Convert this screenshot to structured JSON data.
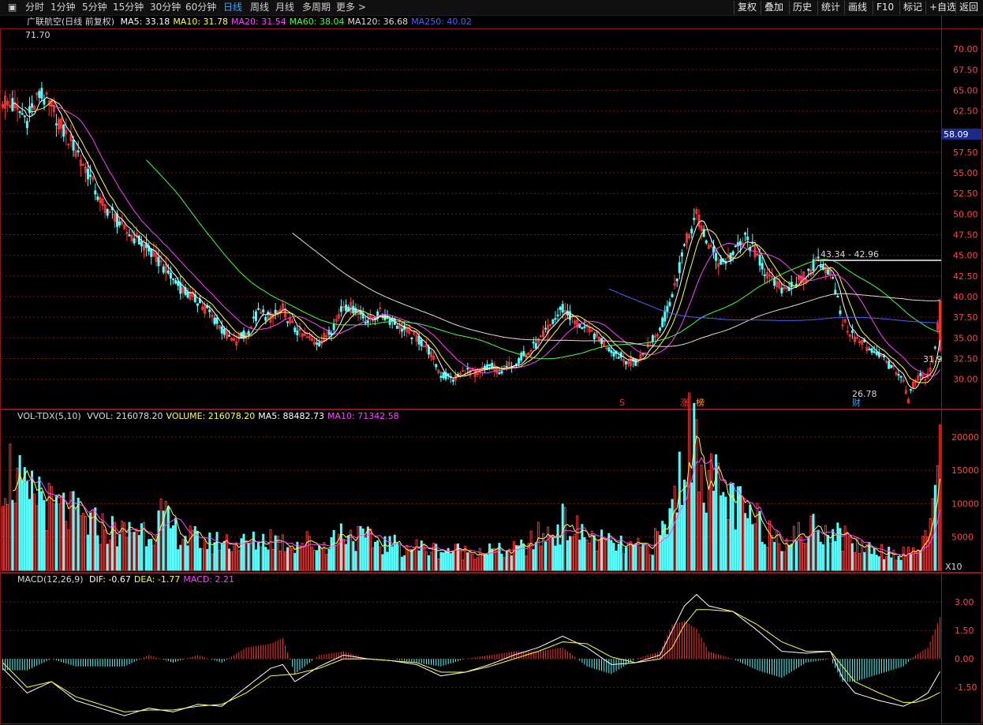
{
  "toolbar": {
    "left_items": [
      "分时",
      "1分钟",
      "5分钟",
      "15分钟",
      "30分钟",
      "60分钟",
      "日线",
      "周线",
      "月线",
      "多周期",
      "更多 >"
    ],
    "active_item": "日线",
    "right_items": [
      "复权",
      "叠加",
      "历史",
      "统计",
      "画线",
      "F10",
      "标记",
      "+自选",
      "返回"
    ]
  },
  "panels": {
    "main": {
      "title": "广联航空(日线 前复权)",
      "ma_legend": [
        {
          "label": "MA5: 33.18",
          "color": "#ffffff"
        },
        {
          "label": "MA10: 31.78",
          "color": "#ffff44"
        },
        {
          "label": "MA20: 31.54",
          "color": "#ff44ff"
        },
        {
          "label": "MA60: 38.04",
          "color": "#44ff44"
        },
        {
          "label": "MA120: 36.68",
          "color": "#dddddd"
        },
        {
          "label": "MA250: 40.02",
          "color": "#4466ff"
        }
      ],
      "annotations": {
        "high_label": "71.70",
        "low_label": "26.78",
        "range_label": "43.34 - 42.96",
        "last_label": "31.9",
        "current_price_tag": "58.09",
        "markers": [
          "S",
          "涨",
          "榜",
          "财"
        ]
      }
    },
    "volume": {
      "title": "VOL-TDX(5,10)",
      "legend": [
        {
          "label": "VVOL: 216078.20",
          "color": "#dddddd"
        },
        {
          "label": "VOLUME: 216078.20",
          "color": "#ffff44"
        },
        {
          "label": "MA5: 88482.73",
          "color": "#ffffff"
        },
        {
          "label": "MA10: 71342.58",
          "color": "#ff44ff"
        }
      ],
      "unit_label": "X10"
    },
    "macd": {
      "title": "MACD(12,26,9)",
      "legend": [
        {
          "label": "DIF: -0.67",
          "color": "#ffffff"
        },
        {
          "label": "DEA: -1.77",
          "color": "#ffff44"
        },
        {
          "label": "MACD: 2.21",
          "color": "#ff44ff"
        }
      ]
    }
  },
  "colors": {
    "up": "#ff3232",
    "down": "#54ffff",
    "grid": "#7a1616",
    "axis_text": "#ff4646"
  },
  "chart_data": [
    {
      "type": "candlestick",
      "title": "广联航空(日线 前复权)",
      "ylim": [
        27.0,
        72.5
      ],
      "yticks": [
        30.0,
        32.5,
        35.0,
        37.5,
        40.0,
        42.5,
        45.0,
        47.5,
        50.0,
        52.5,
        55.0,
        57.5,
        60.0,
        62.5,
        65.0,
        67.5,
        70.0
      ],
      "close_anchors": [
        [
          0,
          64.0
        ],
        [
          5,
          62.8
        ],
        [
          10,
          61.5
        ],
        [
          15,
          64.5
        ],
        [
          20,
          63.0
        ],
        [
          25,
          60.0
        ],
        [
          30,
          58.0
        ],
        [
          35,
          55.0
        ],
        [
          40,
          51.5
        ],
        [
          45,
          50.0
        ],
        [
          50,
          48.0
        ],
        [
          55,
          47.0
        ],
        [
          60,
          45.5
        ],
        [
          65,
          44.0
        ],
        [
          70,
          42.0
        ],
        [
          75,
          40.5
        ],
        [
          80,
          39.5
        ],
        [
          85,
          38.0
        ],
        [
          90,
          36.0
        ],
        [
          95,
          34.5
        ],
        [
          100,
          35.5
        ],
        [
          105,
          38.0
        ],
        [
          110,
          37.5
        ],
        [
          115,
          38.5
        ],
        [
          120,
          36.0
        ],
        [
          125,
          35.0
        ],
        [
          130,
          34.5
        ],
        [
          135,
          36.0
        ],
        [
          140,
          39.0
        ],
        [
          145,
          38.5
        ],
        [
          150,
          37.0
        ],
        [
          155,
          38.0
        ],
        [
          160,
          37.0
        ],
        [
          165,
          36.0
        ],
        [
          170,
          35.0
        ],
        [
          175,
          33.5
        ],
        [
          180,
          30.5
        ],
        [
          185,
          30.0
        ],
        [
          190,
          31.0
        ],
        [
          195,
          30.8
        ],
        [
          200,
          31.5
        ],
        [
          205,
          31.0
        ],
        [
          210,
          32.0
        ],
        [
          215,
          33.0
        ],
        [
          220,
          34.5
        ],
        [
          225,
          36.5
        ],
        [
          230,
          38.5
        ],
        [
          235,
          37.0
        ],
        [
          240,
          36.0
        ],
        [
          245,
          35.0
        ],
        [
          250,
          33.5
        ],
        [
          255,
          32.5
        ],
        [
          260,
          32.0
        ],
        [
          265,
          34.0
        ],
        [
          270,
          36.0
        ],
        [
          275,
          40.0
        ],
        [
          280,
          46.0
        ],
        [
          285,
          50.0
        ],
        [
          290,
          46.0
        ],
        [
          295,
          44.0
        ],
        [
          300,
          45.0
        ],
        [
          305,
          47.0
        ],
        [
          310,
          45.0
        ],
        [
          315,
          42.0
        ],
        [
          320,
          41.0
        ],
        [
          325,
          41.5
        ],
        [
          330,
          42.5
        ],
        [
          335,
          44.5
        ],
        [
          340,
          43.0
        ],
        [
          345,
          37.0
        ],
        [
          350,
          35.0
        ],
        [
          355,
          34.0
        ],
        [
          360,
          33.0
        ],
        [
          365,
          31.5
        ],
        [
          370,
          29.5
        ],
        [
          372,
          27.5
        ],
        [
          375,
          30.0
        ],
        [
          380,
          30.5
        ],
        [
          383,
          33.5
        ],
        [
          385,
          39.5
        ]
      ],
      "ma_series": [
        "MA5",
        "MA10",
        "MA20",
        "MA60",
        "MA120",
        "MA250"
      ]
    },
    {
      "type": "bar",
      "title": "VOL-TDX(5,10)",
      "ylim": [
        0,
        22000
      ],
      "yticks": [
        5000,
        10000,
        15000,
        20000
      ],
      "volume_anchors": [
        [
          0,
          16000
        ],
        [
          5,
          14000
        ],
        [
          10,
          10000
        ],
        [
          15,
          12000
        ],
        [
          20,
          9000
        ],
        [
          25,
          9000
        ],
        [
          30,
          8000
        ],
        [
          35,
          7000
        ],
        [
          40,
          6500
        ],
        [
          45,
          6000
        ],
        [
          50,
          5500
        ],
        [
          55,
          6500
        ],
        [
          60,
          6000
        ],
        [
          65,
          8000
        ],
        [
          70,
          6000
        ],
        [
          75,
          5000
        ],
        [
          80,
          4500
        ],
        [
          85,
          4000
        ],
        [
          90,
          4500
        ],
        [
          95,
          4200
        ],
        [
          100,
          4000
        ],
        [
          105,
          4300
        ],
        [
          110,
          5000
        ],
        [
          115,
          4200
        ],
        [
          120,
          4000
        ],
        [
          125,
          4300
        ],
        [
          130,
          3500
        ],
        [
          135,
          4500
        ],
        [
          140,
          6000
        ],
        [
          145,
          5000
        ],
        [
          150,
          4500
        ],
        [
          155,
          4000
        ],
        [
          160,
          3800
        ],
        [
          165,
          3500
        ],
        [
          170,
          3500
        ],
        [
          175,
          3200
        ],
        [
          180,
          3000
        ],
        [
          185,
          3000
        ],
        [
          190,
          2800
        ],
        [
          195,
          3000
        ],
        [
          200,
          3000
        ],
        [
          205,
          2800
        ],
        [
          210,
          3000
        ],
        [
          215,
          3500
        ],
        [
          220,
          5000
        ],
        [
          225,
          5500
        ],
        [
          230,
          7000
        ],
        [
          235,
          6000
        ],
        [
          240,
          5000
        ],
        [
          245,
          4500
        ],
        [
          250,
          3800
        ],
        [
          255,
          3500
        ],
        [
          260,
          3300
        ],
        [
          265,
          3500
        ],
        [
          270,
          5000
        ],
        [
          275,
          9000
        ],
        [
          280,
          18000
        ],
        [
          285,
          20000
        ],
        [
          290,
          14000
        ],
        [
          295,
          11000
        ],
        [
          300,
          10000
        ],
        [
          305,
          8000
        ],
        [
          310,
          7000
        ],
        [
          315,
          6000
        ],
        [
          320,
          5000
        ],
        [
          325,
          5000
        ],
        [
          330,
          5500
        ],
        [
          335,
          7000
        ],
        [
          340,
          6000
        ],
        [
          345,
          5000
        ],
        [
          350,
          4000
        ],
        [
          355,
          3500
        ],
        [
          360,
          3000
        ],
        [
          365,
          2800
        ],
        [
          370,
          2500
        ],
        [
          375,
          3000
        ],
        [
          380,
          6000
        ],
        [
          383,
          9000
        ],
        [
          385,
          21800
        ]
      ]
    },
    {
      "type": "bar",
      "title": "MACD(12,26,9)",
      "ylim": [
        -3.2,
        3.8
      ],
      "yticks": [
        -1.5,
        0.0,
        1.5,
        3.0
      ],
      "dif_anchors": [
        [
          0,
          -0.5
        ],
        [
          10,
          -1.8
        ],
        [
          20,
          -1.2
        ],
        [
          30,
          -2.2
        ],
        [
          40,
          -2.6
        ],
        [
          50,
          -3.0
        ],
        [
          60,
          -2.6
        ],
        [
          70,
          -2.8
        ],
        [
          80,
          -2.4
        ],
        [
          90,
          -2.5
        ],
        [
          100,
          -1.5
        ],
        [
          110,
          -0.5
        ],
        [
          115,
          -0.3
        ],
        [
          120,
          -1.2
        ],
        [
          130,
          -0.4
        ],
        [
          140,
          0.2
        ],
        [
          150,
          0.0
        ],
        [
          160,
          -0.1
        ],
        [
          170,
          -0.3
        ],
        [
          180,
          -0.9
        ],
        [
          190,
          -0.7
        ],
        [
          200,
          -0.3
        ],
        [
          210,
          0.2
        ],
        [
          220,
          0.6
        ],
        [
          230,
          1.2
        ],
        [
          240,
          0.6
        ],
        [
          250,
          -0.3
        ],
        [
          260,
          -0.2
        ],
        [
          270,
          0.2
        ],
        [
          275,
          1.5
        ],
        [
          280,
          2.8
        ],
        [
          285,
          3.4
        ],
        [
          290,
          2.8
        ],
        [
          300,
          2.5
        ],
        [
          310,
          1.5
        ],
        [
          320,
          0.4
        ],
        [
          330,
          0.3
        ],
        [
          340,
          0.4
        ],
        [
          345,
          -1.0
        ],
        [
          350,
          -1.8
        ],
        [
          360,
          -2.2
        ],
        [
          370,
          -2.5
        ],
        [
          375,
          -2.2
        ],
        [
          380,
          -1.8
        ],
        [
          385,
          -0.67
        ]
      ],
      "dea_anchors": [
        [
          0,
          -0.2
        ],
        [
          10,
          -1.5
        ],
        [
          20,
          -1.2
        ],
        [
          30,
          -2.0
        ],
        [
          40,
          -2.4
        ],
        [
          50,
          -2.8
        ],
        [
          60,
          -2.7
        ],
        [
          70,
          -2.7
        ],
        [
          80,
          -2.5
        ],
        [
          90,
          -2.4
        ],
        [
          100,
          -1.8
        ],
        [
          110,
          -0.9
        ],
        [
          120,
          -0.8
        ],
        [
          130,
          -0.5
        ],
        [
          140,
          0.0
        ],
        [
          150,
          0.0
        ],
        [
          160,
          -0.1
        ],
        [
          170,
          -0.2
        ],
        [
          180,
          -0.7
        ],
        [
          190,
          -0.7
        ],
        [
          200,
          -0.4
        ],
        [
          210,
          0.0
        ],
        [
          220,
          0.4
        ],
        [
          230,
          0.9
        ],
        [
          240,
          0.8
        ],
        [
          250,
          0.1
        ],
        [
          260,
          -0.2
        ],
        [
          270,
          0.0
        ],
        [
          275,
          0.6
        ],
        [
          280,
          1.8
        ],
        [
          285,
          2.6
        ],
        [
          290,
          2.6
        ],
        [
          300,
          2.5
        ],
        [
          310,
          1.8
        ],
        [
          320,
          0.9
        ],
        [
          330,
          0.4
        ],
        [
          340,
          0.4
        ],
        [
          345,
          -0.4
        ],
        [
          350,
          -1.2
        ],
        [
          360,
          -1.8
        ],
        [
          370,
          -2.3
        ],
        [
          375,
          -2.3
        ],
        [
          380,
          -2.1
        ],
        [
          385,
          -1.77
        ]
      ]
    }
  ]
}
